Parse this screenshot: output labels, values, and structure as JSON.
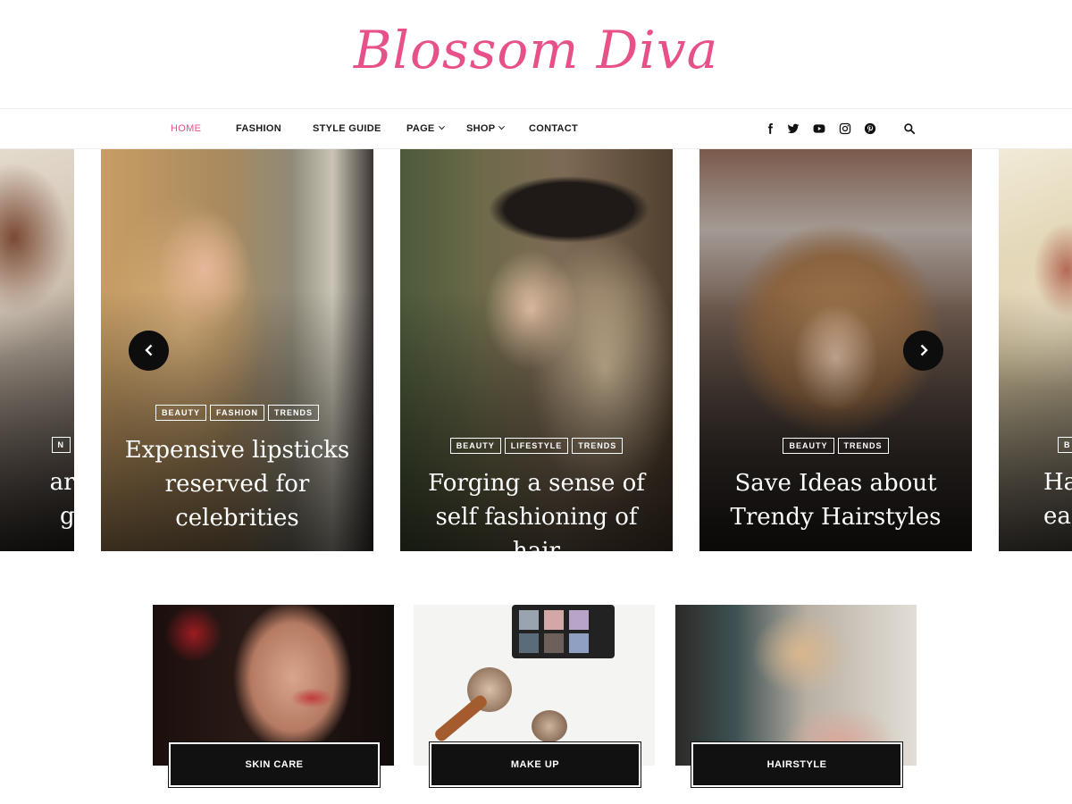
{
  "site": {
    "logo": "Blossom Diva",
    "brand_color": "#e8508a"
  },
  "nav": {
    "items": [
      {
        "label": "HOME",
        "active": true
      },
      {
        "label": "FASHION"
      },
      {
        "label": "STYLE GUIDE"
      },
      {
        "label": "PAGE",
        "dropdown": true
      },
      {
        "label": "SHOP",
        "dropdown": true
      },
      {
        "label": "CONTACT"
      }
    ],
    "social_icons": [
      "facebook-icon",
      "twitter-icon",
      "youtube-icon",
      "instagram-icon",
      "pinterest-icon"
    ],
    "search_icon": "search-icon"
  },
  "slider": {
    "slides": [
      {
        "tags": [
          "N"
        ],
        "title_lines": [
          "are",
          "ge"
        ],
        "partial": true
      },
      {
        "tags": [
          "BEAUTY",
          "FASHION",
          "TRENDS"
        ],
        "title_lines": [
          "Expensive lipsticks",
          "reserved for",
          "celebrities"
        ]
      },
      {
        "tags": [
          "BEAUTY",
          "LIFESTYLE",
          "TRENDS"
        ],
        "title_lines": [
          "Forging a sense of",
          "self fashioning of hair"
        ]
      },
      {
        "tags": [
          "BEAUTY",
          "TRENDS"
        ],
        "title_lines": [
          "Save Ideas about",
          "Trendy Hairstyles"
        ]
      },
      {
        "tags": [
          "B"
        ],
        "title_lines": [
          "Ha",
          "ea"
        ],
        "partial": true
      }
    ],
    "prev_icon": "chevron-left-icon",
    "next_icon": "chevron-right-icon"
  },
  "categories": [
    {
      "label": "SKIN CARE"
    },
    {
      "label": "MAKE UP"
    },
    {
      "label": "HAIRSTYLE"
    }
  ]
}
